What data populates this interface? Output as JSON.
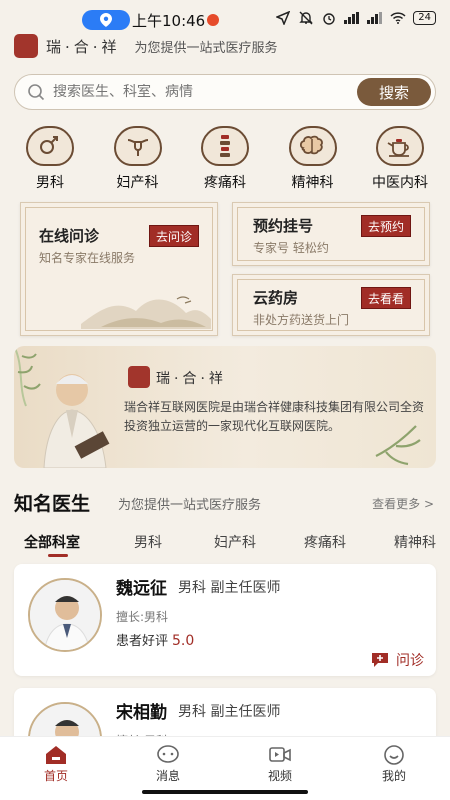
{
  "status_bar": {
    "time": "上午10:46",
    "battery": "24"
  },
  "brand": {
    "seal_text": "瑞合祥",
    "name": "瑞·合·祥",
    "slogan": "为您提供一站式医疗服务"
  },
  "search": {
    "placeholder": "搜索医生、科室、病情",
    "button_label": "搜索"
  },
  "categories": [
    {
      "label": "男科",
      "icon": "male-icon"
    },
    {
      "label": "妇产科",
      "icon": "uterus-icon"
    },
    {
      "label": "疼痛科",
      "icon": "spine-icon"
    },
    {
      "label": "精神科",
      "icon": "brain-icon"
    },
    {
      "label": "中医内科",
      "icon": "teapot-icon"
    }
  ],
  "services": {
    "online": {
      "title": "在线问诊",
      "subtitle": "知名专家在线服务",
      "button": "去问诊"
    },
    "appointment": {
      "title": "预约挂号",
      "subtitle": "专家号 轻松约",
      "button": "去预约"
    },
    "pharmacy": {
      "title": "云药房",
      "subtitle": "非处方药送货上门",
      "button": "去看看"
    }
  },
  "banner": {
    "seal_text": "瑞合祥",
    "name": "瑞·合·祥",
    "text": "瑞合祥互联网医院是由瑞合祥健康科技集团有限公司全资投资独立运营的一家现代化互联网医院。"
  },
  "doctors_section": {
    "title": "知名医生",
    "subtitle": "为您提供一站式医疗服务",
    "more": "查看更多 >",
    "tabs": [
      "全部科室",
      "男科",
      "妇产科",
      "疼痛科",
      "精神科"
    ]
  },
  "doctors": [
    {
      "name": "魏远征",
      "meta": "男科  副主任医师",
      "specialty": "擅长:男科",
      "rating_label": "患者好评",
      "rating": "5.0",
      "consult": "问诊"
    },
    {
      "name": "宋相勤",
      "meta": "男科  副主任医师",
      "specialty": "擅长:男科"
    }
  ],
  "bottom_nav": [
    {
      "label": "首页",
      "icon": "home-icon"
    },
    {
      "label": "消息",
      "icon": "message-icon"
    },
    {
      "label": "视频",
      "icon": "video-icon"
    },
    {
      "label": "我的",
      "icon": "profile-icon"
    }
  ],
  "colors": {
    "accent": "#a12d26",
    "brown": "#7a5a3c",
    "background": "#f5f1ea"
  }
}
